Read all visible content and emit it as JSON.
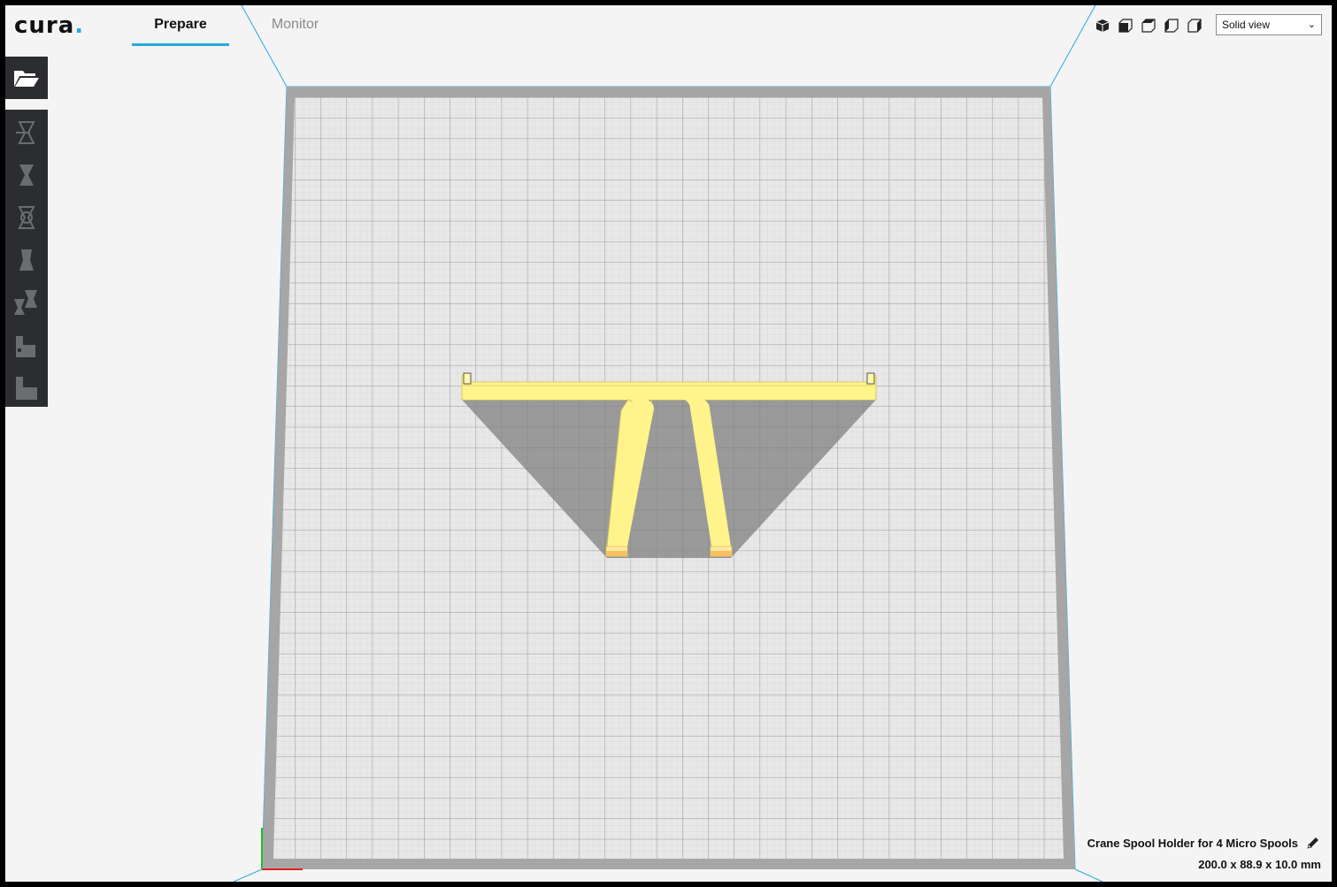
{
  "app": {
    "logo_text": "cura",
    "logo_dot": ".",
    "accent_color": "#29a9e0"
  },
  "tabs": [
    {
      "label": "Prepare",
      "active": true
    },
    {
      "label": "Monitor",
      "active": false
    }
  ],
  "view_controls": {
    "camera_buttons": [
      "3d-view-icon",
      "front-view-icon",
      "top-view-icon",
      "left-view-icon",
      "right-view-icon"
    ],
    "view_mode": "Solid view"
  },
  "toolbar": {
    "open_icon": "folder-open-icon",
    "tools": [
      "move-tool-icon",
      "scale-tool-icon",
      "rotate-tool-icon",
      "mirror-tool-icon",
      "per-model-settings-icon",
      "support-blocker-icon",
      "custom-support-icon"
    ]
  },
  "object_info": {
    "name": "Crane Spool Holder for 4 Micro Spools",
    "dimensions": "200.0 x 88.9 x 10.0 mm",
    "edit_icon": "pencil-icon"
  },
  "colors": {
    "model": "#fff38c",
    "plate": "#e6e6e6",
    "border": "#a6a6a6",
    "toolbar": "#2b2d30"
  }
}
